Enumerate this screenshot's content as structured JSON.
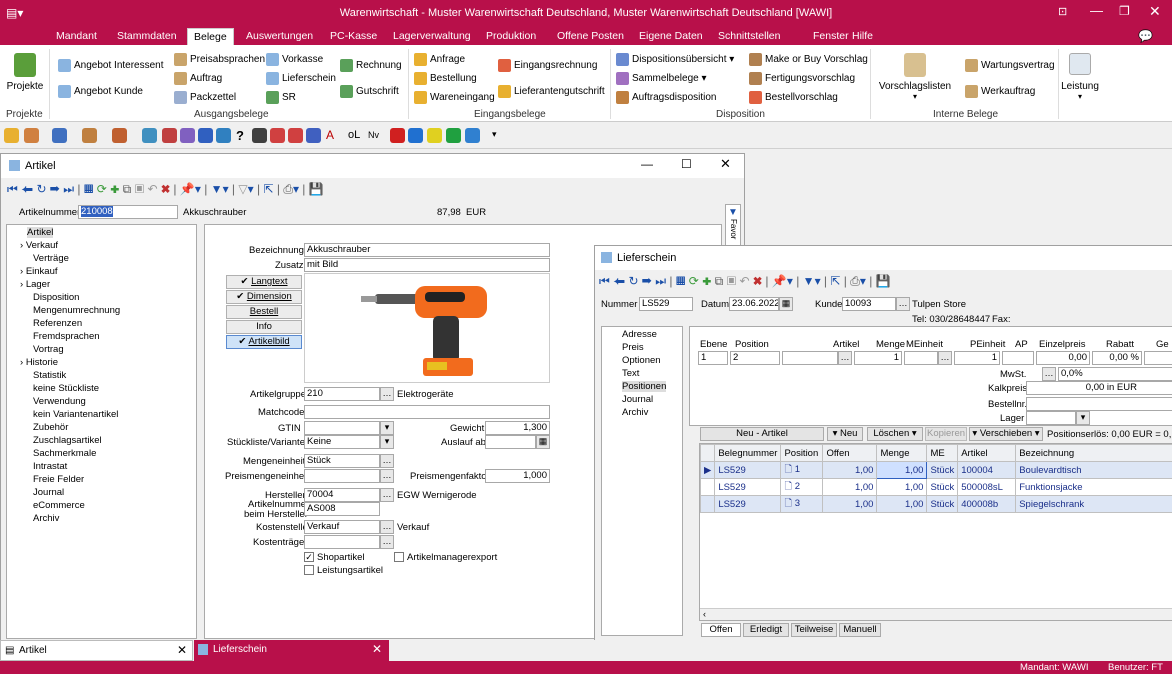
{
  "app": {
    "title": "Warenwirtschaft - Muster Warenwirtschaft Deutschland, Muster Warenwirtschaft Deutschland [WAWI]"
  },
  "tabs": [
    "Mandant",
    "Stammdaten",
    "Belege",
    "Auswertungen",
    "PC-Kasse",
    "Lagerverwaltung",
    "Produktion",
    "Offene Posten",
    "Eigene Daten",
    "Schnittstellen",
    "Fenster",
    "Hilfe"
  ],
  "ribbon": {
    "projekte": "Projekte",
    "projekte_group": "Projekte",
    "angebot_interessent": "Angebot Interessent",
    "angebot_kunde": "Angebot Kunde",
    "preisabsprachen": "Preisabsprachen",
    "auftrag": "Auftrag",
    "packzettel": "Packzettel",
    "vorkasse": "Vorkasse",
    "lieferschein": "Lieferschein",
    "sr": "SR",
    "rechnung": "Rechnung",
    "gutschrift": "Gutschrift",
    "ausgang_group": "Ausgangsbelege",
    "anfrage": "Anfrage",
    "bestellung": "Bestellung",
    "wareneingang": "Wareneingang",
    "eingangsrechnung": "Eingangsrechnung",
    "lieferantengutschrift": "Lieferantengutschrift",
    "eingang_group": "Eingangsbelege",
    "dispositionsuebersicht": "Dispositionsübersicht",
    "sammelbelege": "Sammelbelege",
    "auftragsdisposition": "Auftragsdisposition",
    "make_or_buy": "Make or Buy Vorschlag",
    "fertigungsvorschlag": "Fertigungsvorschlag",
    "bestellvorschlag": "Bestellvorschlag",
    "dispo_group": "Disposition",
    "vorschlagslisten": "Vorschlagslisten",
    "wartungsvertrag": "Wartungsvertrag",
    "werkauftrag": "Werkauftrag",
    "intern_group": "Interne Belege",
    "leistung": "Leistung"
  },
  "artikel": {
    "title": "Artikel",
    "nummer_label": "Artikelnummer",
    "nummer": "210008",
    "name": "Akkuschrauber",
    "preis": "87,98",
    "waehrung": "EUR",
    "tree": [
      "Artikel",
      "Verkauf",
      "Verträge",
      "Einkauf",
      "Lager",
      "Disposition",
      "Mengenumrechnung",
      "Referenzen",
      "Fremdsprachen",
      "Vortrag",
      "Historie",
      "Statistik",
      "keine Stückliste",
      "Verwendung",
      "kein Variantenartikel",
      "Zubehör",
      "Zuschlagsartikel",
      "Sachmerkmale",
      "Intrastat",
      "Freie Felder",
      "Journal",
      "eCommerce",
      "Archiv"
    ],
    "bezeichnung_label": "Bezeichnung",
    "bezeichnung": "Akkuschrauber",
    "zusatz_label": "Zusatz",
    "zusatz": "mit Bild",
    "btn_langtext": "Langtext",
    "btn_dimension": "Dimension",
    "btn_bestell": "Bestell",
    "btn_info": "Info",
    "btn_artikelbild": "Artikelbild",
    "artikelgruppe_label": "Artikelgruppe",
    "artikelgruppe": "210",
    "artikelgruppe_name": "Elektrogeräte",
    "matchcode_label": "Matchcode",
    "gtin_label": "GTIN",
    "gewicht_label": "Gewicht",
    "gewicht": "1,300",
    "stueckliste_label": "Stückliste/Variante",
    "stueckliste": "Keine",
    "auslauf_label": "Auslauf ab",
    "mengeneinheit_label": "Mengeneinheit",
    "mengeneinheit": "Stück",
    "preismengeneinheit_label": "Preismengeneinheit",
    "preismengenfaktor_label": "Preismengenfaktor",
    "preismengenfaktor": "1,000",
    "hersteller_label": "Hersteller",
    "hersteller": "70004",
    "hersteller_name": "EGW Wernigerode",
    "art_hersteller_label1": "Artikelnummer",
    "art_hersteller_label2": "beim Hersteller",
    "art_hersteller": "AS008",
    "kostenstelle_label": "Kostenstelle",
    "kostenstelle": "Verkauf",
    "kostenstelle_name": "Verkauf",
    "kostentraeger_label": "Kostenträger",
    "shopartikel": "Shopartikel",
    "artikelmanagerexport": "Artikelmanagerexport",
    "leistungsartikel": "Leistungsartikel",
    "favoriten": "Favor"
  },
  "lieferschein": {
    "title": "Lieferschein",
    "nummer_label": "Nummer",
    "nummer": "LS529",
    "datum_label": "Datum",
    "datum": "23.06.2022",
    "kunde_label": "Kunde",
    "kunde": "10093",
    "kunde_name": "Tulpen Store",
    "tel": "Tel: 030/28648447",
    "fax": "Fax:",
    "tree": [
      "Adresse",
      "Preis",
      "Optionen",
      "Text",
      "Positionen",
      "Journal",
      "Archiv"
    ],
    "head": {
      "ebene": "Ebene",
      "position": "Position",
      "artikel": "Artikel",
      "menge": "Menge",
      "meinheit": "MEinheit",
      "peinheit": "PEinheit",
      "ap": "AP",
      "einzelpreis": "Einzelpreis",
      "rabatt": "Rabatt",
      "ge": "Ge"
    },
    "row": {
      "ebene": "1",
      "position": "2",
      "menge": "1",
      "peinheit": "1",
      "einzelpreis": "0,00",
      "rabatt": "0,00 %"
    },
    "mwst_label": "MwSt.",
    "mwst": "0,0%",
    "kalkpreis_label": "Kalkpreis",
    "kalkpreis": "0,00 in EUR",
    "bestellnr_label": "Bestellnr.",
    "lager_label": "Lager",
    "btn_neu_artikel": "Neu - Artikel",
    "btn_neu": "Neu",
    "btn_loeschen": "Löschen",
    "btn_kopieren": "Kopieren",
    "btn_verschieben": "Verschieben",
    "positionserloes": "Positionserlös: 0,00 EUR = 0,",
    "grid_cols": [
      "Belegnummer",
      "Position",
      "Offen",
      "Menge",
      "ME",
      "Artikel",
      "Bezeichnung"
    ],
    "grid_rows": [
      {
        "beleg": "LS529",
        "pos": "1",
        "offen": "1,00",
        "menge": "1,00",
        "me": "Stück",
        "artikel": "100004",
        "bez": "Boulevardtisch"
      },
      {
        "beleg": "LS529",
        "pos": "2",
        "offen": "1,00",
        "menge": "1,00",
        "me": "Stück",
        "artikel": "500008sL",
        "bez": "Funktionsjacke"
      },
      {
        "beleg": "LS529",
        "pos": "3",
        "offen": "1,00",
        "menge": "1,00",
        "me": "Stück",
        "artikel": "400008b",
        "bez": "Spiegelschrank"
      }
    ],
    "filter_tabs": [
      "Offen",
      "Erledigt",
      "Teilweise",
      "Manuell"
    ]
  },
  "bottomtabs": {
    "artikel": "Artikel",
    "lieferschein": "Lieferschein"
  },
  "status": {
    "mandant": "Mandant: WAWI",
    "benutzer": "Benutzer: FT"
  }
}
